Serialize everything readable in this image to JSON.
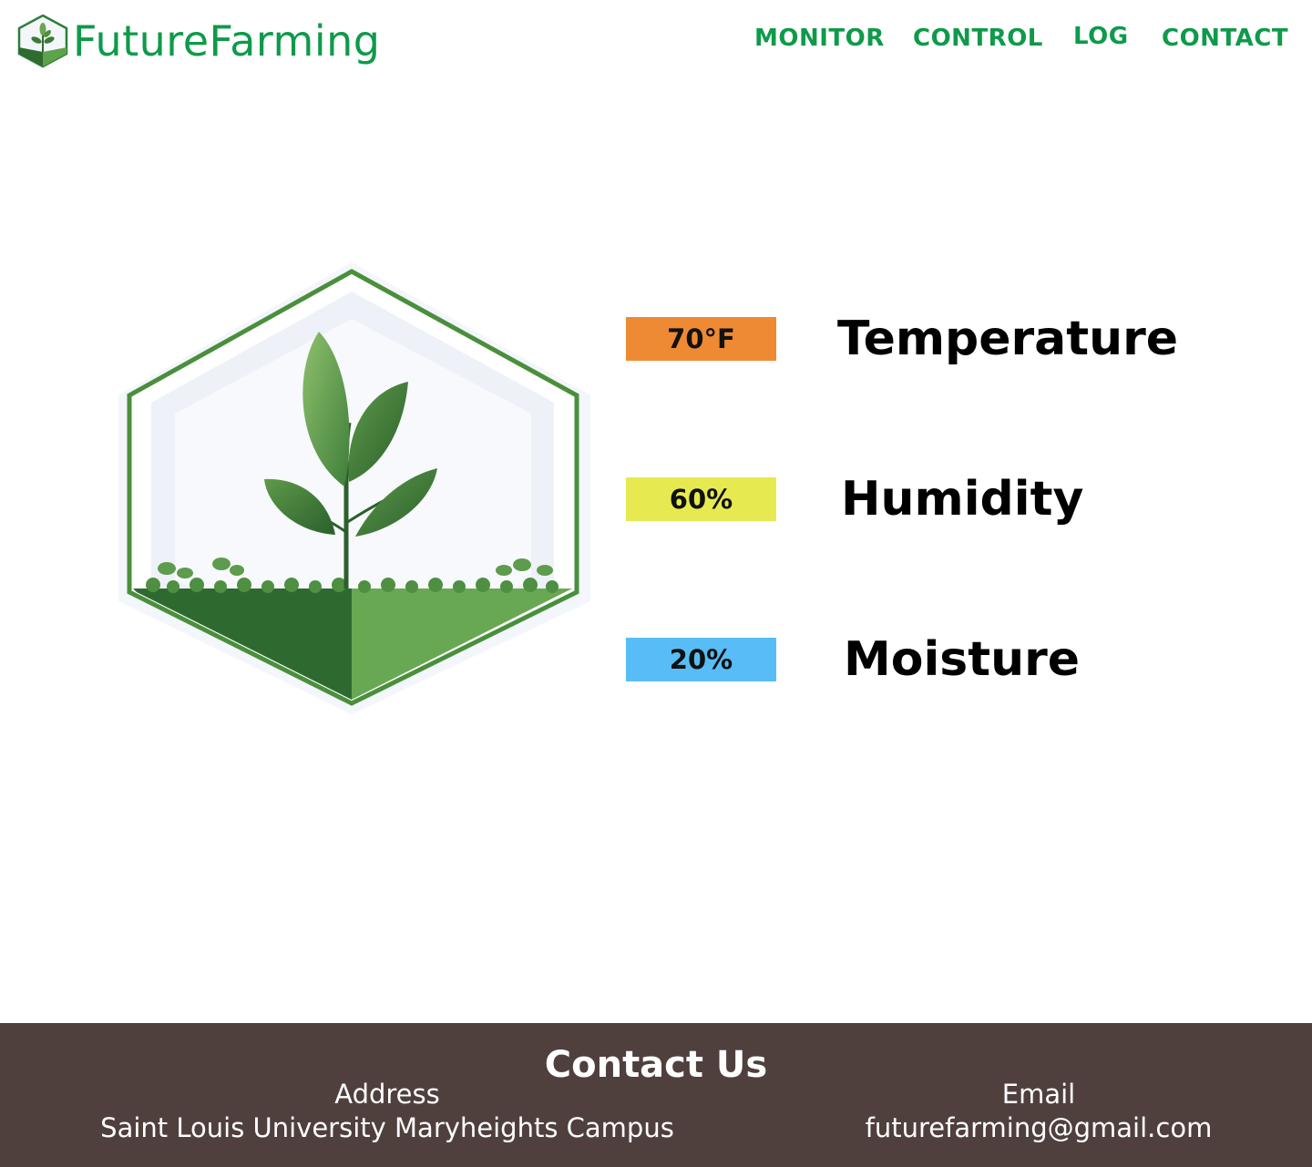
{
  "brand": {
    "name": "FutureFarming",
    "color": "#0e9a4a"
  },
  "nav": {
    "items": [
      "MONITOR",
      "CONTROL",
      "LOG",
      "CONTACT"
    ]
  },
  "metrics": [
    {
      "value": "70°F",
      "label": "Temperature",
      "color": "#ee8a33"
    },
    {
      "value": "60%",
      "label": "Humidity",
      "color": "#e6ea50"
    },
    {
      "value": "20%",
      "label": "Moisture",
      "color": "#58bdf6"
    }
  ],
  "hero": {
    "image_icon": "plant-in-hexagon-illustration"
  },
  "footer": {
    "title": "Contact Us",
    "address_heading": "Address",
    "address_value": "Saint Louis University Maryheights Campus",
    "email_heading": "Email",
    "email_value": "futurefarming@gmail.com",
    "background": "#4f403e"
  }
}
